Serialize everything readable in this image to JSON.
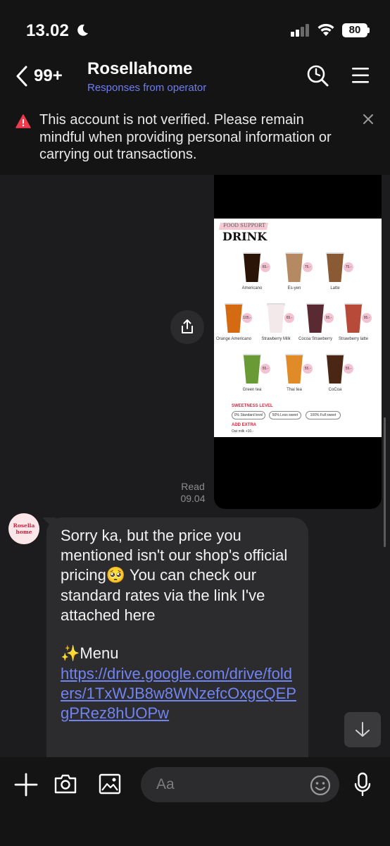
{
  "status_bar": {
    "time": "13.02",
    "battery": "80"
  },
  "header": {
    "back_count": "99+",
    "title": "Rosellahome",
    "subtitle": "Responses from operator"
  },
  "warning": {
    "text": "This account is not verified. Please remain mindful when providing personal information or carrying out transactions."
  },
  "menu_image": {
    "tag": "FOOD SUPPORT",
    "heading": "DRINK",
    "drinks": [
      {
        "name": "Americano",
        "price": "65.-",
        "color": "#2a1408"
      },
      {
        "name": "Es-yen",
        "price": "75.-",
        "color": "#b58a62"
      },
      {
        "name": "Latte",
        "price": "75.-",
        "color": "#8a5a34"
      },
      {
        "name": "Orange Americano",
        "price": "105.-",
        "color": "#d46a12"
      },
      {
        "name": "Strawberry Milk",
        "price": "65.-",
        "color": "#f3e8ea"
      },
      {
        "name": "Cocoa Strawberry",
        "price": "95.-",
        "color": "#5a2a32"
      },
      {
        "name": "Strawberry latte",
        "price": "95.-",
        "color": "#b84a3a"
      },
      {
        "name": "Green tea",
        "price": "55.-",
        "color": "#6a9a36"
      },
      {
        "name": "Thai tea",
        "price": "55.-",
        "color": "#e08a28"
      },
      {
        "name": "CoCoa",
        "price": "55.-",
        "color": "#4a2614"
      }
    ],
    "sweetness_title": "SWEETNESS LEVEL",
    "sweetness": [
      "0% Standard level",
      "50% Less sweet",
      "100% Full sweet"
    ],
    "extra_title": "ADD EXTRA",
    "extra_item": "Oat milk +10.-"
  },
  "read_status": {
    "label": "Read",
    "time": "09.04"
  },
  "avatar": {
    "name": "Rosella home"
  },
  "message": {
    "text": "Sorry ka, but the price you mentioned isn't our shop's official pricing🥺 You can check our standard rates via the link I've attached here",
    "menu_label": "✨Menu",
    "link": "https://drive.google.com/drive/folders/1TxWJB8w8WNzefcOxgcQEPgPRez8hUOPw"
  },
  "input": {
    "placeholder": "Aa"
  },
  "icons": [
    "moon-icon",
    "signal-icon",
    "wifi-icon",
    "back-icon",
    "search-icon",
    "menu-icon",
    "warning-icon",
    "close-icon",
    "share-icon",
    "arrow-down-icon",
    "plus-icon",
    "camera-icon",
    "image-icon",
    "emoji-icon",
    "mic-icon"
  ]
}
